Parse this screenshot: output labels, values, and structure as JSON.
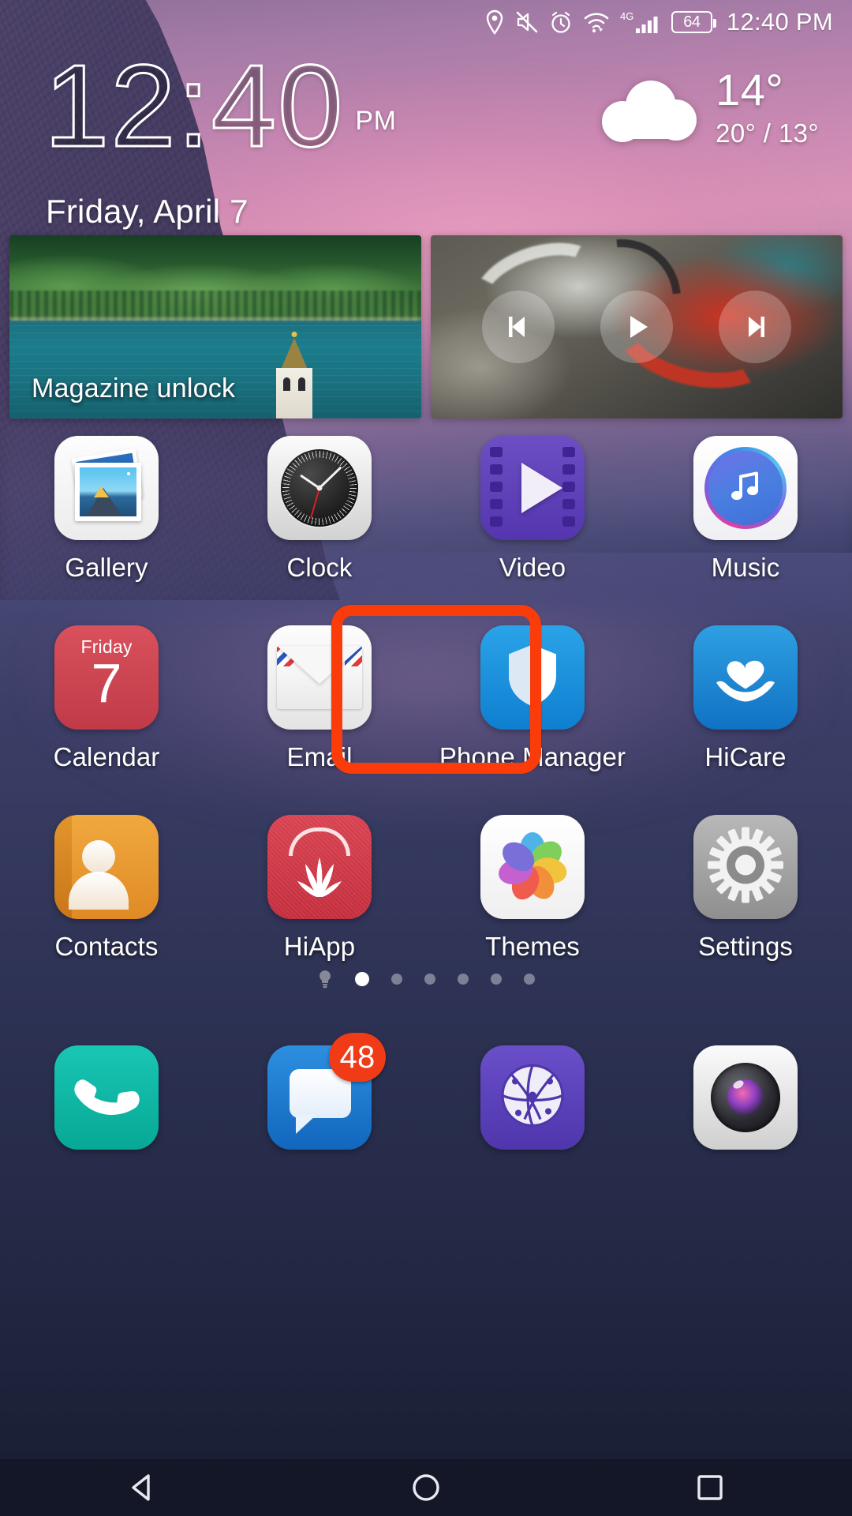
{
  "status_bar": {
    "icons": [
      "location-icon",
      "mute-icon",
      "alarm-icon",
      "wifi-icon",
      "signal-4g-icon"
    ],
    "network_label": "4G",
    "battery_level": "64",
    "time": "12:40 PM"
  },
  "clock_widget": {
    "time": "12:40",
    "meridiem": "PM",
    "date": "Friday, April 7",
    "weather": {
      "condition_icon": "cloud-icon",
      "current_temp": "14°",
      "range": "20° / 13°"
    }
  },
  "cards": {
    "magazine": {
      "label": "Magazine unlock"
    },
    "music": {
      "previous_label": "skip-previous-icon",
      "play_label": "play-icon",
      "next_label": "skip-next-icon"
    }
  },
  "app_grid": [
    [
      {
        "label": "Gallery",
        "icon": "gallery-icon"
      },
      {
        "label": "Clock",
        "icon": "clock-icon"
      },
      {
        "label": "Video",
        "icon": "video-icon"
      },
      {
        "label": "Music",
        "icon": "music-icon"
      }
    ],
    [
      {
        "label": "Calendar",
        "icon": "calendar-icon",
        "day": "Friday",
        "date": "7"
      },
      {
        "label": "Email",
        "icon": "email-icon"
      },
      {
        "label": "Phone Manager",
        "icon": "shield-icon",
        "highlighted": true
      },
      {
        "label": "HiCare",
        "icon": "heart-hand-icon"
      }
    ],
    [
      {
        "label": "Contacts",
        "icon": "contacts-icon"
      },
      {
        "label": "HiApp",
        "icon": "huawei-flower-icon"
      },
      {
        "label": "Themes",
        "icon": "flower-petals-icon"
      },
      {
        "label": "Settings",
        "icon": "gear-icon"
      }
    ]
  ],
  "page_indicator": {
    "total": 6,
    "active_index": 0,
    "leading_icon": "bulb-icon"
  },
  "dock": [
    {
      "label": "Phone",
      "icon": "phone-handset-icon",
      "badge": ""
    },
    {
      "label": "Messages",
      "icon": "message-bubble-icon",
      "badge": "48"
    },
    {
      "label": "Browser",
      "icon": "globe-icon",
      "badge": ""
    },
    {
      "label": "Camera",
      "icon": "camera-lens-icon",
      "badge": ""
    }
  ],
  "nav_bar": {
    "back": "back-icon",
    "home": "home-icon",
    "recents": "recents-icon"
  },
  "colors": {
    "highlight": "#fa3c0a",
    "badge": "#f03b16",
    "accent_blue": "#1b8fdc"
  }
}
